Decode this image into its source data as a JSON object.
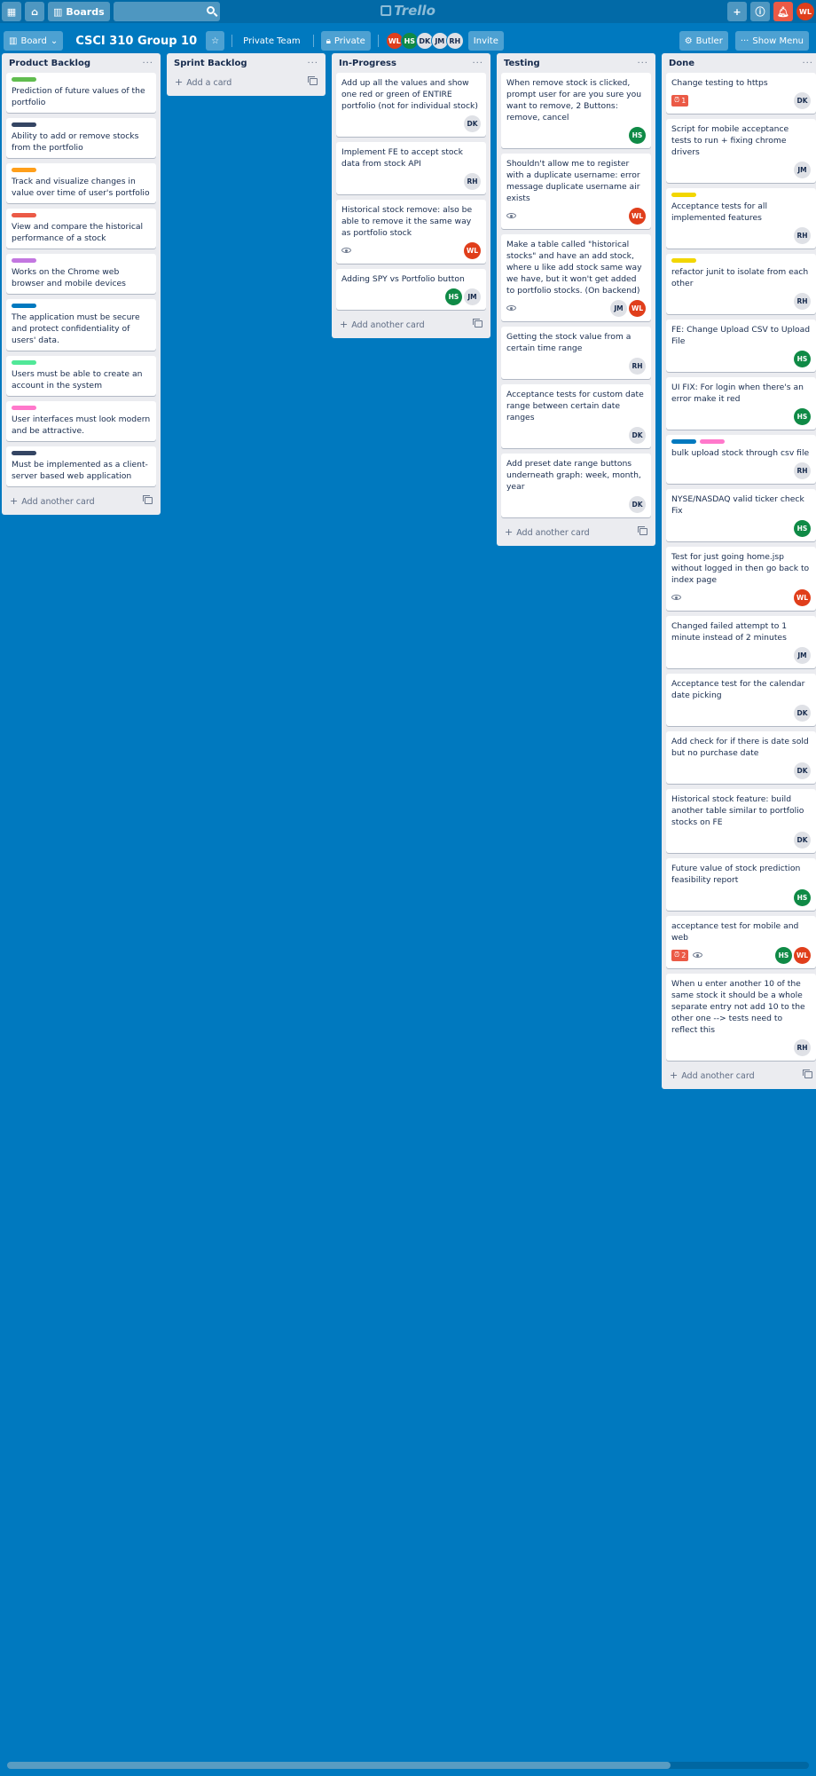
{
  "topbar": {
    "boards_label": "Boards",
    "logo_text": "Trello"
  },
  "header": {
    "board_view_label": "Board",
    "board_title": "CSCI 310 Group 10",
    "team_label": "Private Team",
    "visibility_label": "Private",
    "members": [
      "WL",
      "HS",
      "DK",
      "JM",
      "RH"
    ],
    "invite_label": "Invite",
    "butler_label": "Butler",
    "menu_label": "Show Menu",
    "user_initials": "WL"
  },
  "lists": [
    {
      "title": "Product Backlog",
      "add_label": "Add another card",
      "cards": [
        {
          "text": "Prediction of future values of the portfolio",
          "labels": [
            "#61bd4f"
          ]
        },
        {
          "text": "Ability to add or remove stocks from the portfolio",
          "labels": [
            "#344563"
          ]
        },
        {
          "text": "Track and visualize changes in value over time of user's portfolio",
          "labels": [
            "#ff9f1a"
          ]
        },
        {
          "text": "View and compare the historical performance of a stock",
          "labels": [
            "#eb5a46"
          ]
        },
        {
          "text": "Works on the Chrome web browser and mobile devices",
          "labels": [
            "#c377e0"
          ]
        },
        {
          "text": "The application must be secure and protect confidentiality of users' data.",
          "labels": [
            "#0079bf"
          ]
        },
        {
          "text": "Users must be able to create an account in the system",
          "labels": [
            "#51e898"
          ]
        },
        {
          "text": "User interfaces must look modern and be attractive.",
          "labels": [
            "#ff78cb"
          ]
        },
        {
          "text": "Must be implemented as a client-server based web application",
          "labels": [
            "#344563"
          ]
        }
      ]
    },
    {
      "title": "Sprint Backlog",
      "add_label": "Add a card",
      "cards": []
    },
    {
      "title": "In-Progress",
      "add_label": "Add another card",
      "cards": [
        {
          "text": "Add up all the values and show one red or green of ENTIRE portfolio (not for individual stock)",
          "members": [
            "DK"
          ]
        },
        {
          "text": "Implement FE to accept stock data from stock API",
          "members": [
            "RH"
          ]
        },
        {
          "text": "Historical stock remove: also be able to remove it the same way as portfolio stock",
          "watch": true,
          "members": [
            "WL"
          ]
        },
        {
          "text": "Adding SPY vs Portfolio button",
          "members": [
            "HS",
            "JM"
          ]
        }
      ]
    },
    {
      "title": "Testing",
      "add_label": "Add another card",
      "cards": [
        {
          "text": "When remove stock is clicked, prompt user for are you sure you want to remove, 2 Buttons: remove, cancel",
          "members": [
            "HS"
          ]
        },
        {
          "text": "Shouldn't allow me to register with a duplicate username: error message duplicate username air exists",
          "watch": true,
          "members": [
            "WL"
          ]
        },
        {
          "text": "Make a table called \"historical stocks\" and have an add stock, where u like add stock same way we have, but it won't get added to portfolio stocks. (On backend)",
          "watch": true,
          "members": [
            "JM",
            "WL"
          ]
        },
        {
          "text": "Getting the stock value from a certain time range",
          "members": [
            "RH"
          ]
        },
        {
          "text": "Acceptance tests for custom date range between certain date ranges",
          "members": [
            "DK"
          ]
        },
        {
          "text": "Add preset date range buttons underneath graph: week, month, year",
          "members": [
            "DK"
          ]
        }
      ]
    },
    {
      "title": "Done",
      "add_label": "Add another card",
      "cards": [
        {
          "text": "Change testing to https",
          "alert": "1",
          "members": [
            "DK"
          ]
        },
        {
          "text": "Script for mobile acceptance tests to run + fixing chrome drivers",
          "members": [
            "JM"
          ]
        },
        {
          "text": "Acceptance tests for all implemented features",
          "labels": [
            "#f2d600"
          ],
          "members": [
            "RH"
          ]
        },
        {
          "text": "refactor junit to isolate from each other",
          "labels": [
            "#f2d600"
          ],
          "members": [
            "RH"
          ]
        },
        {
          "text": "FE: Change Upload CSV to Upload File",
          "members": [
            "HS"
          ]
        },
        {
          "text": "UI FIX: For login when there's an error make it red",
          "members": [
            "HS"
          ]
        },
        {
          "text": "bulk upload stock through csv file",
          "labels": [
            "#0079bf",
            "#ff78cb"
          ],
          "members": [
            "RH"
          ]
        },
        {
          "text": "NYSE/NASDAQ valid ticker check Fix",
          "members": [
            "HS"
          ]
        },
        {
          "text": "Test for just going home.jsp without logged in then go back to index page",
          "watch": true,
          "members": [
            "WL"
          ]
        },
        {
          "text": "Changed failed attempt to 1 minute instead of 2 minutes",
          "members": [
            "JM"
          ]
        },
        {
          "text": "Acceptance test for the calendar date picking",
          "members": [
            "DK"
          ]
        },
        {
          "text": "Add check for if there is date sold but no purchase date",
          "members": [
            "DK"
          ]
        },
        {
          "text": "Historical stock feature: build another table similar to portfolio stocks on FE",
          "members": [
            "DK"
          ]
        },
        {
          "text": "Future value of stock prediction feasibility report",
          "members": [
            "HS"
          ]
        },
        {
          "text": "acceptance test for mobile and web",
          "alert": "2",
          "watch": true,
          "members": [
            "HS",
            "WL"
          ]
        },
        {
          "text": "When u enter another 10 of the same stock it should be a whole separate entry not add 10 to the other one --> tests need to reflect this",
          "members": [
            "RH"
          ]
        }
      ]
    }
  ],
  "colors": {
    "board_bg": "#0079bf",
    "topbar_bg": "#026aa7",
    "list_bg": "#ebecf0",
    "alert_red": "#eb5a46"
  }
}
